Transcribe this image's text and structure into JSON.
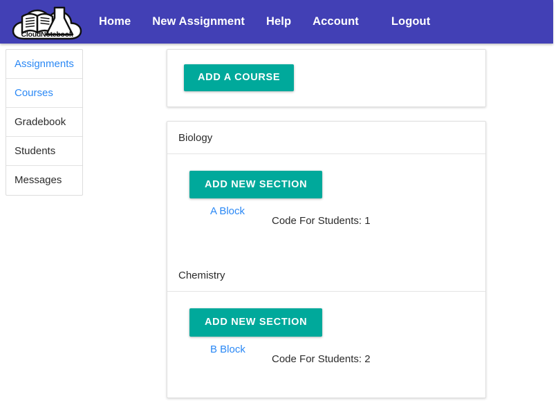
{
  "navbar": {
    "brand_text": "CloudNotebook",
    "brand_icon": "cloud-book-flask-logo",
    "background_color": "#4240b5",
    "links": [
      {
        "label": "Home",
        "name": "nav-link-home"
      },
      {
        "label": "New Assignment",
        "name": "nav-link-new-assignment"
      },
      {
        "label": "Help",
        "name": "nav-link-help"
      },
      {
        "label": "Account",
        "name": "nav-link-account"
      },
      {
        "label": "Logout",
        "name": "nav-link-logout"
      }
    ]
  },
  "sidebar": {
    "items": [
      {
        "label": "Assignments",
        "is_link": true
      },
      {
        "label": "Courses",
        "is_link": true
      },
      {
        "label": "Gradebook",
        "is_link": false
      },
      {
        "label": "Students",
        "is_link": false
      },
      {
        "label": "Messages",
        "is_link": false
      }
    ],
    "link_color": "#2a88f5",
    "text_color": "#2b2b2b"
  },
  "main": {
    "add_course_button": "ADD A COURSE",
    "accent_color": "#00a99b",
    "courses": [
      {
        "name": "Biology",
        "add_section_button": "ADD NEW SECTION",
        "section_label": "A Block",
        "code_label": "Code For Students: 1"
      },
      {
        "name": "Chemistry",
        "add_section_button": "ADD NEW SECTION",
        "section_label": "B Block",
        "code_label": "Code For Students: 2"
      }
    ]
  }
}
